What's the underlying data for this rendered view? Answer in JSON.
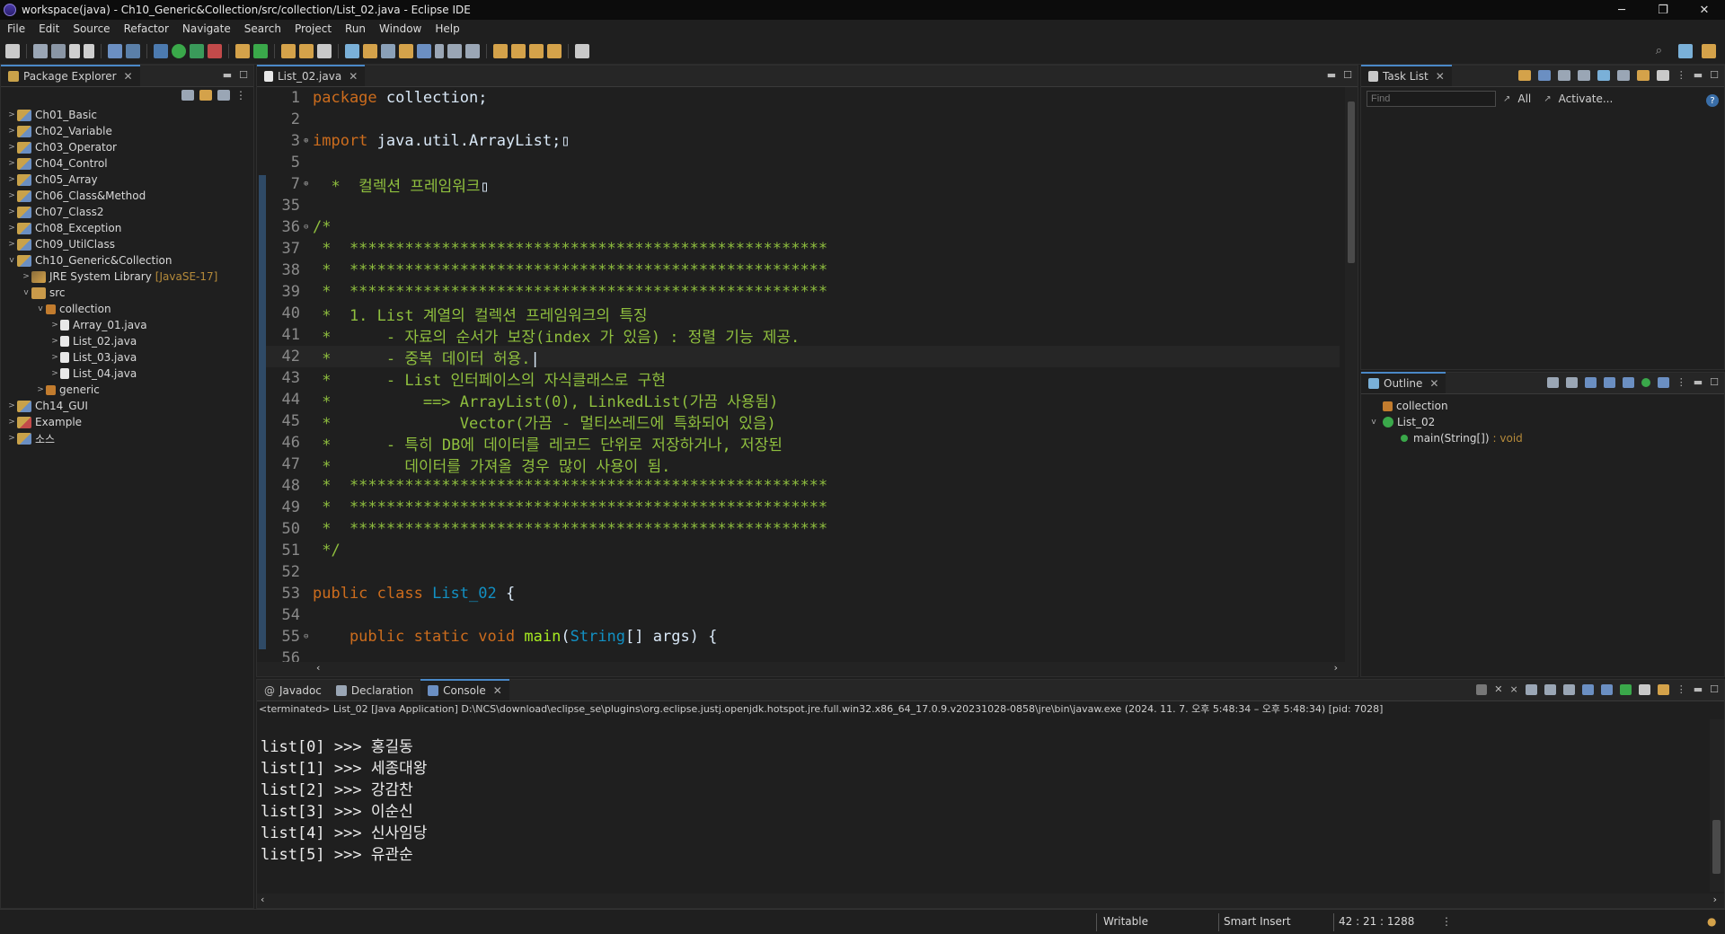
{
  "window": {
    "title": "workspace(java) - Ch10_Generic&Collection/src/collection/List_02.java - Eclipse IDE",
    "minimize": "─",
    "restore": "❐",
    "close": "✕"
  },
  "menu": [
    "File",
    "Edit",
    "Source",
    "Refactor",
    "Navigate",
    "Search",
    "Project",
    "Run",
    "Window",
    "Help"
  ],
  "package_explorer": {
    "title": "Package Explorer",
    "items": [
      {
        "label": "Ch01_Basic",
        "level": 0,
        "icon": "project",
        "arrow": ">"
      },
      {
        "label": "Ch02_Variable",
        "level": 0,
        "icon": "project",
        "arrow": ">"
      },
      {
        "label": "Ch03_Operator",
        "level": 0,
        "icon": "project",
        "arrow": ">"
      },
      {
        "label": "Ch04_Control",
        "level": 0,
        "icon": "project",
        "arrow": ">"
      },
      {
        "label": "Ch05_Array",
        "level": 0,
        "icon": "project",
        "arrow": ">"
      },
      {
        "label": "Ch06_Class&Method",
        "level": 0,
        "icon": "project",
        "arrow": ">"
      },
      {
        "label": "Ch07_Class2",
        "level": 0,
        "icon": "project",
        "arrow": ">"
      },
      {
        "label": "Ch08_Exception",
        "level": 0,
        "icon": "project",
        "arrow": ">"
      },
      {
        "label": "Ch09_UtilClass",
        "level": 0,
        "icon": "project",
        "arrow": ">"
      },
      {
        "label": "Ch10_Generic&Collection",
        "level": 0,
        "icon": "project",
        "arrow": "v"
      },
      {
        "label": "JRE System Library",
        "suffix": "[JavaSE-17]",
        "level": 1,
        "icon": "jre",
        "arrow": ">"
      },
      {
        "label": "src",
        "level": 1,
        "icon": "src",
        "arrow": "v"
      },
      {
        "label": "collection",
        "level": 2,
        "icon": "package",
        "arrow": "v"
      },
      {
        "label": "Array_01.java",
        "level": 3,
        "icon": "java",
        "arrow": ">"
      },
      {
        "label": "List_02.java",
        "level": 3,
        "icon": "java",
        "arrow": ">"
      },
      {
        "label": "List_03.java",
        "level": 3,
        "icon": "java",
        "arrow": ">"
      },
      {
        "label": "List_04.java",
        "level": 3,
        "icon": "java",
        "arrow": ">"
      },
      {
        "label": "generic",
        "level": 2,
        "icon": "package",
        "arrow": ">"
      },
      {
        "label": "Ch14_GUI",
        "level": 0,
        "icon": "project",
        "arrow": ">"
      },
      {
        "label": "Example",
        "level": 0,
        "icon": "project-error",
        "arrow": ">"
      },
      {
        "label": "소스",
        "level": 0,
        "icon": "project",
        "arrow": ">"
      }
    ]
  },
  "editor": {
    "tab": "List_02.java",
    "lines": [
      {
        "n": "1",
        "fold": "",
        "parts": [
          [
            "kw",
            "package"
          ],
          [
            "plain",
            " collection;"
          ]
        ]
      },
      {
        "n": "2",
        "fold": "",
        "parts": []
      },
      {
        "n": "3",
        "fold": "⊕",
        "parts": [
          [
            "kw",
            "import"
          ],
          [
            "plain",
            " java.util.ArrayList;"
          ],
          [
            "plain",
            "▯"
          ]
        ]
      },
      {
        "n": "5",
        "fold": "",
        "parts": []
      },
      {
        "n": "7",
        "fold": "⊕",
        "parts": [
          [
            "cm",
            "  *  컬렉션 프레임워크"
          ],
          [
            "plain",
            "▯"
          ]
        ]
      },
      {
        "n": "35",
        "fold": "",
        "parts": []
      },
      {
        "n": "36",
        "fold": "⊖",
        "parts": [
          [
            "cm",
            "/*"
          ]
        ]
      },
      {
        "n": "37",
        "fold": "",
        "parts": [
          [
            "cm",
            " *  ****************************************************"
          ]
        ]
      },
      {
        "n": "38",
        "fold": "",
        "parts": [
          [
            "cm",
            " *  ****************************************************"
          ]
        ]
      },
      {
        "n": "39",
        "fold": "",
        "parts": [
          [
            "cm",
            " *  ****************************************************"
          ]
        ]
      },
      {
        "n": "40",
        "fold": "",
        "parts": [
          [
            "cm",
            " *  1. List 계열의 컬렉션 프레임워크의 특징"
          ]
        ]
      },
      {
        "n": "41",
        "fold": "",
        "parts": [
          [
            "cm",
            " *      - 자료의 순서가 보장(index 가 있음) : 정렬 기능 제공."
          ]
        ]
      },
      {
        "n": "42",
        "fold": "",
        "current": true,
        "parts": [
          [
            "cm",
            " *      - 중복 데이터 허용."
          ],
          [
            "plain",
            "|"
          ]
        ]
      },
      {
        "n": "43",
        "fold": "",
        "parts": [
          [
            "cm",
            " *      - List 인터페이스의 자식클래스로 구현"
          ]
        ]
      },
      {
        "n": "44",
        "fold": "",
        "parts": [
          [
            "cm",
            " *          ==> ArrayList(0), LinkedList(가끔 사용됨)"
          ]
        ]
      },
      {
        "n": "45",
        "fold": "",
        "parts": [
          [
            "cm",
            " *              Vector(가끔 - 멀티쓰레드에 특화되어 있음)"
          ]
        ]
      },
      {
        "n": "46",
        "fold": "",
        "parts": [
          [
            "cm",
            " *      - 특히 DB에 데이터를 레코드 단위로 저장하거나, 저장된"
          ]
        ]
      },
      {
        "n": "47",
        "fold": "",
        "parts": [
          [
            "cm",
            " *        데이터를 가져올 경우 많이 사용이 됨."
          ]
        ]
      },
      {
        "n": "48",
        "fold": "",
        "parts": [
          [
            "cm",
            " *  ****************************************************"
          ]
        ]
      },
      {
        "n": "49",
        "fold": "",
        "parts": [
          [
            "cm",
            " *  ****************************************************"
          ]
        ]
      },
      {
        "n": "50",
        "fold": "",
        "parts": [
          [
            "cm",
            " *  ****************************************************"
          ]
        ]
      },
      {
        "n": "51",
        "fold": "",
        "parts": [
          [
            "cm",
            " */"
          ]
        ]
      },
      {
        "n": "52",
        "fold": "",
        "parts": []
      },
      {
        "n": "53",
        "fold": "",
        "parts": [
          [
            "kw",
            "public class "
          ],
          [
            "cls",
            "List_02"
          ],
          [
            "plain",
            " {"
          ]
        ]
      },
      {
        "n": "54",
        "fold": "",
        "parts": []
      },
      {
        "n": "55",
        "fold": "⊖",
        "parts": [
          [
            "kw",
            "    public static void "
          ],
          [
            "mth",
            "main"
          ],
          [
            "plain",
            "("
          ],
          [
            "cls",
            "String"
          ],
          [
            "plain",
            "[] args) {"
          ]
        ]
      },
      {
        "n": "56",
        "fold": "",
        "parts": []
      }
    ]
  },
  "task_list": {
    "title": "Task List",
    "find_placeholder": "Find",
    "all": "All",
    "activate": "Activate..."
  },
  "outline": {
    "title": "Outline",
    "items": [
      {
        "label": "collection",
        "level": 0
      },
      {
        "label": "List_02",
        "level": 0
      },
      {
        "label": "main(String[])",
        "suffix": ": void",
        "level": 1
      }
    ]
  },
  "bottom": {
    "tabs": [
      "Javadoc",
      "Declaration",
      "Console"
    ],
    "active": "Console",
    "terminated": "<terminated> List_02 [Java Application] D:\\NCS\\download\\eclipse_se\\plugins\\org.eclipse.justj.openjdk.hotspot.jre.full.win32.x86_64_17.0.9.v20231028-0858\\jre\\bin\\javaw.exe  (2024. 11. 7. 오후 5:48:34 – 오후 5:48:34) [pid: 7028]",
    "output": [
      "list[0] >>> 홍길동",
      "list[1] >>> 세종대왕",
      "list[2] >>> 강감찬",
      "list[3] >>> 이순신",
      "list[4] >>> 신사임당",
      "list[5] >>> 유관순"
    ]
  },
  "status": {
    "writable": "Writable",
    "insert": "Smart Insert",
    "position": "42 : 21 : 1288"
  }
}
